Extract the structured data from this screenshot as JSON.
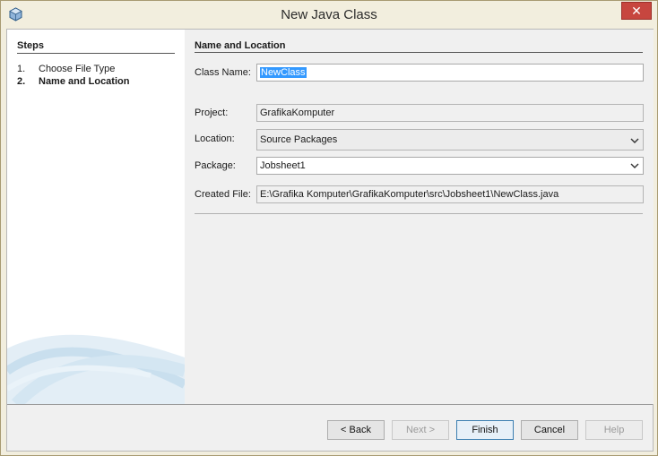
{
  "window": {
    "title": "New Java Class",
    "close_glyph": "✕"
  },
  "steps": {
    "title": "Steps",
    "items": [
      {
        "num": "1.",
        "label": "Choose File Type",
        "current": false
      },
      {
        "num": "2.",
        "label": "Name and Location",
        "current": true
      }
    ]
  },
  "form": {
    "section_title": "Name and Location",
    "class_name": {
      "label": "Class Name:",
      "value": "NewClass"
    },
    "project": {
      "label": "Project:",
      "value": "GrafikaKomputer"
    },
    "location": {
      "label": "Location:",
      "value": "Source Packages"
    },
    "package": {
      "label": "Package:",
      "value": "Jobsheet1"
    },
    "created_file": {
      "label": "Created File:",
      "value": "E:\\Grafika Komputer\\GrafikaKomputer\\src\\Jobsheet1\\NewClass.java"
    }
  },
  "buttons": {
    "back": "< Back",
    "next": "Next >",
    "finish": "Finish",
    "cancel": "Cancel",
    "help": "Help"
  },
  "icons": {
    "app": "java-cube-icon",
    "close": "close-icon",
    "dropdown": "chevron-down-icon"
  },
  "colors": {
    "close_button": "#c7463f",
    "selection": "#3399ff"
  }
}
